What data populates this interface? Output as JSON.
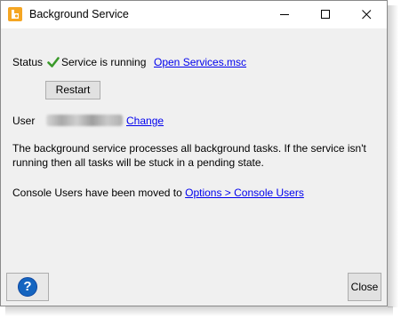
{
  "window": {
    "title": "Background Service",
    "icon": "app-logo-icon",
    "controls": {
      "minimize": "minimize-icon",
      "maximize": "maximize-icon",
      "close": "close-icon"
    }
  },
  "status": {
    "label": "Status",
    "icon": "checkmark-icon",
    "text": "Service is running",
    "link": "Open Services.msc",
    "color": "#3a9a2a"
  },
  "restart_button": "Restart",
  "user": {
    "label": "User",
    "change_link": "Change"
  },
  "description": "The background service processes all background tasks.  If the service isn't running then all tasks will be stuck in a pending state.",
  "console_users": {
    "text": "Console Users have been moved to ",
    "link": "Options > Console Users"
  },
  "footer": {
    "help_icon": "help-icon",
    "help_glyph": "?",
    "close_label": "Close"
  },
  "colors": {
    "link": "#0000ee",
    "help": "#1565c0",
    "icon_orange": "#f5a623"
  }
}
